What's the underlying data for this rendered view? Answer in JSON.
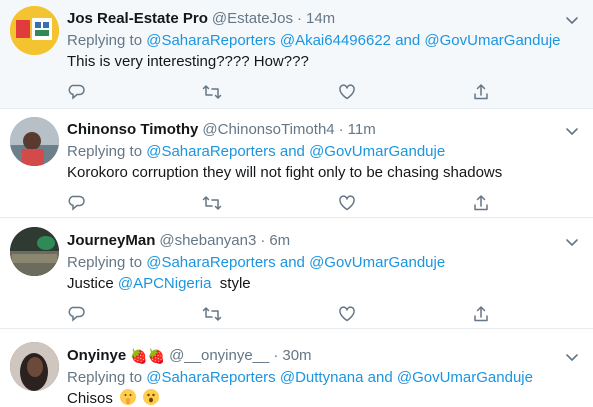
{
  "tweets": [
    {
      "name": "Jos Real-Estate Pro",
      "handle": "@EstateJos",
      "time": "14m",
      "replying_prefix": "Replying to",
      "mentions": [
        "@SaharaReporters",
        "@Akai64496622",
        "and",
        "@GovUmarGanduje"
      ],
      "text": "This is very interesting???? How???",
      "avatar_color": "#f4c430"
    },
    {
      "name": "Chinonso Timothy",
      "handle": "@ChinonsoTimoth4",
      "time": "11m",
      "replying_prefix": "Replying to",
      "mentions": [
        "@SaharaReporters",
        "and",
        "@GovUmarGanduje"
      ],
      "text": "Korokoro corruption they will not fight only to be chasing shadows",
      "avatar_color": "#8a9aa6"
    },
    {
      "name": "JourneyMan",
      "handle": "@shebanyan3",
      "time": "6m",
      "replying_prefix": "Replying to",
      "mentions": [
        "@SaharaReporters",
        "and",
        "@GovUmarGanduje"
      ],
      "text_prefix": "Justice",
      "text_mention": "@APCNigeria",
      "text_suffix": "style",
      "avatar_color": "#3a3f3a"
    },
    {
      "name": "Onyinye",
      "name_emoji": "🍓🍓",
      "handle": "@__onyinye__",
      "time": "30m",
      "replying_prefix": "Replying to",
      "mentions": [
        "@SaharaReporters",
        "@Duttynana",
        "and",
        "@GovUmarGanduje"
      ],
      "text": "Chisos",
      "avatar_color": "#5a4a44"
    }
  ],
  "colors": {
    "link": "#1b95e0",
    "muted": "#657786",
    "icon": "#657786",
    "divider": "#e6ecf0"
  },
  "icons": [
    "reply-icon",
    "retweet-icon",
    "like-icon",
    "share-icon",
    "caret-down-icon"
  ]
}
